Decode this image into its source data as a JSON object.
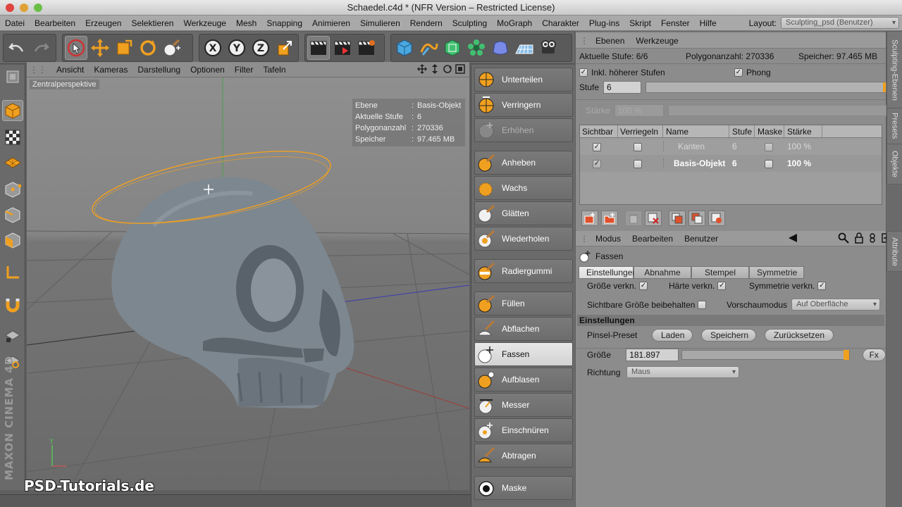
{
  "window": {
    "title": "Schaedel.c4d * (NFR Version – Restricted License)"
  },
  "menubar": {
    "items": [
      "Datei",
      "Bearbeiten",
      "Erzeugen",
      "Selektieren",
      "Werkzeuge",
      "Mesh",
      "Snapping",
      "Animieren",
      "Simulieren",
      "Rendern",
      "Sculpting",
      "MoGraph",
      "Charakter",
      "Plug-ins",
      "Skript",
      "Fenster",
      "Hilfe"
    ],
    "layout_label": "Layout:",
    "layout_value": "Sculpting_psd (Benutzer)"
  },
  "viewport": {
    "menu": [
      "Ansicht",
      "Kameras",
      "Darstellung",
      "Optionen",
      "Filter",
      "Tafeln"
    ],
    "camera": "Zentralperspektive",
    "hud": [
      {
        "k": "Ebene",
        "v": "Basis-Objekt"
      },
      {
        "k": "Aktuelle Stufe",
        "v": "6"
      },
      {
        "k": "Polygonanzahl",
        "v": "270336"
      },
      {
        "k": "Speicher",
        "v": "97.465 MB"
      }
    ],
    "axis_y": "Y",
    "watermark": "PSD-Tutorials.de",
    "maxon": "MAXON CINEMA 4D"
  },
  "sculpt_tools": [
    {
      "label": "Unterteilen",
      "state": "normal"
    },
    {
      "label": "Verringern",
      "state": "normal"
    },
    {
      "label": "Erhöhen",
      "state": "dim"
    },
    {
      "label": "Anheben",
      "state": "normal"
    },
    {
      "label": "Wachs",
      "state": "normal"
    },
    {
      "label": "Glätten",
      "state": "normal"
    },
    {
      "label": "Wiederholen",
      "state": "normal"
    },
    {
      "label": "Radiergummi",
      "state": "normal"
    },
    {
      "label": "Füllen",
      "state": "normal"
    },
    {
      "label": "Abflachen",
      "state": "normal"
    },
    {
      "label": "Fassen",
      "state": "active"
    },
    {
      "label": "Aufblasen",
      "state": "normal"
    },
    {
      "label": "Messer",
      "state": "normal"
    },
    {
      "label": "Einschnüren",
      "state": "normal"
    },
    {
      "label": "Abtragen",
      "state": "normal"
    },
    {
      "label": "Maske",
      "state": "normal"
    }
  ],
  "layers_panel": {
    "tabs": [
      "Ebenen",
      "Werkzeuge"
    ],
    "aktuelle_stufe": "Aktuelle Stufe: 6/6",
    "polygonanzahl": "Polygonanzahl: 270336",
    "speicher": "Speicher: 97.465 MB",
    "inkl_label": "Inkl. höherer Stufen",
    "phong_label": "Phong",
    "stufe_label": "Stufe",
    "stufe_value": "6",
    "staerke_label": "Stärke",
    "staerke_value": "100 %",
    "columns": [
      "Sichtbar",
      "Verriegeln",
      "Name",
      "Stufe",
      "Maske",
      "Stärke"
    ],
    "rows": [
      {
        "name": "Kanten",
        "stufe": "6",
        "staerke": "100 %",
        "dim": true
      },
      {
        "name": "Basis-Objekt",
        "stufe": "6",
        "staerke": "100 %",
        "dim": false
      }
    ],
    "side_tabs": [
      "Sculpting-Ebenen",
      "Presets",
      "Objekte"
    ]
  },
  "attributes": {
    "menu": [
      "Modus",
      "Bearbeiten",
      "Benutzer"
    ],
    "object": "Fassen",
    "tabs": [
      "Einstellungen",
      "Abnahme",
      "Stempel",
      "Symmetrie"
    ],
    "groesse_verkn": "Größe verkn.",
    "haerte_verkn": "Härte verkn.",
    "symmetrie_verkn": "Symmetrie verkn.",
    "sichtbare": "Sichtbare Größe beibehalten",
    "vorschau_label": "Vorschaumodus",
    "vorschau_value": "Auf Oberfläche",
    "section": "Einstellungen",
    "pinsel_label": "Pinsel-Preset",
    "laden": "Laden",
    "speichern": "Speichern",
    "zuruecksetzen": "Zurücksetzen",
    "groesse_label": "Größe",
    "groesse_value": "181.897",
    "fx": "Fx",
    "richtung_label": "Richtung",
    "richtung_value": "Maus",
    "side_tab": "Attribute"
  },
  "colors": {
    "accent_orange": "#f0a020",
    "viewport_bg": "#848484",
    "skull": "#7d8790"
  }
}
